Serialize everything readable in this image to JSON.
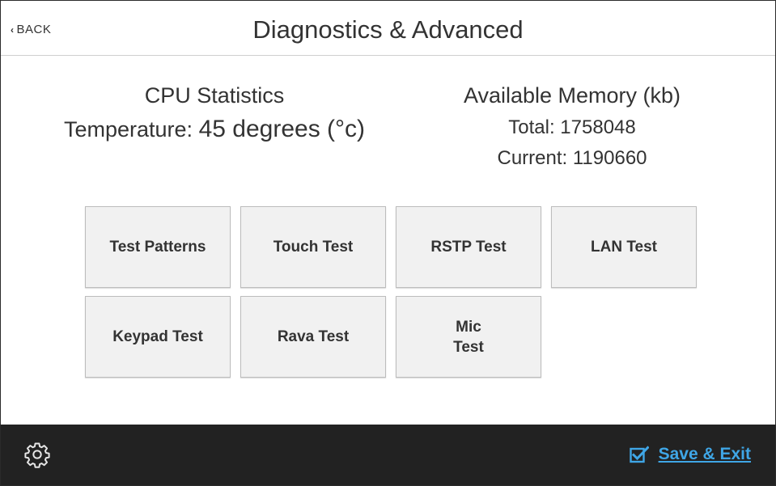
{
  "header": {
    "back_label": "BACK",
    "title": "Diagnostics & Advanced"
  },
  "cpu": {
    "heading": "CPU Statistics",
    "temperature_label": "Temperature:",
    "temperature_value": "45 degrees (°c)"
  },
  "memory": {
    "heading": "Available Memory (kb)",
    "total_label": "Total:",
    "total_value": "1758048",
    "current_label": "Current:",
    "current_value": "1190660"
  },
  "buttons": [
    {
      "label": "Test Patterns"
    },
    {
      "label": "Touch Test"
    },
    {
      "label": "RSTP Test"
    },
    {
      "label": "LAN Test"
    },
    {
      "label": "Keypad Test"
    },
    {
      "label": "Rava Test"
    },
    {
      "label": "Mic\nTest"
    }
  ],
  "footer": {
    "settings_icon": "gear-icon",
    "save_label": "Save & Exit",
    "save_icon": "checkbox-icon",
    "accent_color": "#3fa6e6",
    "footer_color": "#222222"
  }
}
